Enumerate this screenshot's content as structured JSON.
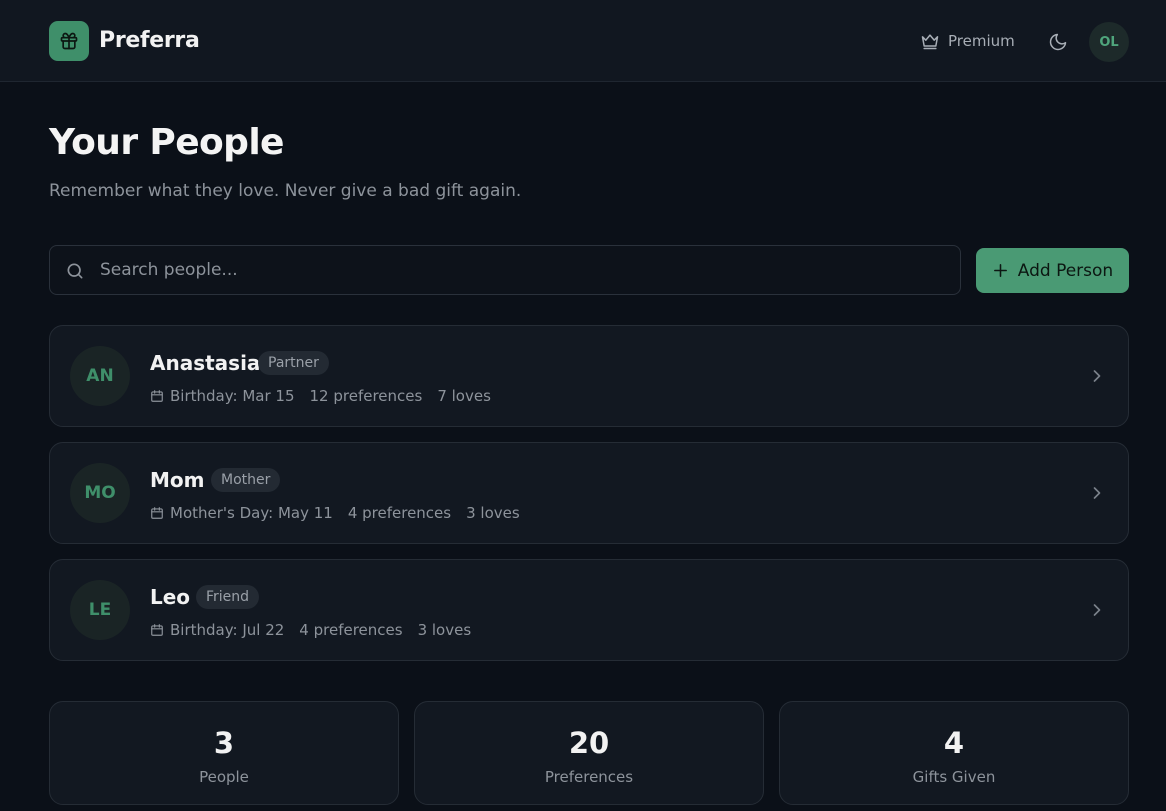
{
  "header": {
    "brand": "Preferra",
    "premium_label": "Premium",
    "user_initials": "OL"
  },
  "page": {
    "title": "Your People",
    "subtitle": "Remember what they love. Never give a bad gift again."
  },
  "search": {
    "placeholder": "Search people...",
    "value": ""
  },
  "add_button": {
    "label": "Add Person"
  },
  "people": [
    {
      "initials": "AN",
      "name": "Anastasia",
      "relation": "Partner",
      "date": "Birthday: Mar 15",
      "preferences": "12 preferences",
      "loves": "7 loves"
    },
    {
      "initials": "MO",
      "name": "Mom",
      "relation": "Mother",
      "date": "Mother's Day: May 11",
      "preferences": "4 preferences",
      "loves": "3 loves"
    },
    {
      "initials": "LE",
      "name": "Leo",
      "relation": "Friend",
      "date": "Birthday: Jul 22",
      "preferences": "4 preferences",
      "loves": "3 loves"
    }
  ],
  "stats": [
    {
      "value": "3",
      "label": "People"
    },
    {
      "value": "20",
      "label": "Preferences"
    },
    {
      "value": "4",
      "label": "Gifts Given"
    }
  ],
  "colors": {
    "accent": "#4a9a74",
    "background": "#0b1018",
    "card": "#121821"
  },
  "icons": {
    "logo": "gift-icon",
    "premium": "crown-icon",
    "theme": "moon-icon",
    "search": "search-icon",
    "add": "plus-icon",
    "date": "calendar-icon",
    "open": "chevron-right-icon"
  }
}
